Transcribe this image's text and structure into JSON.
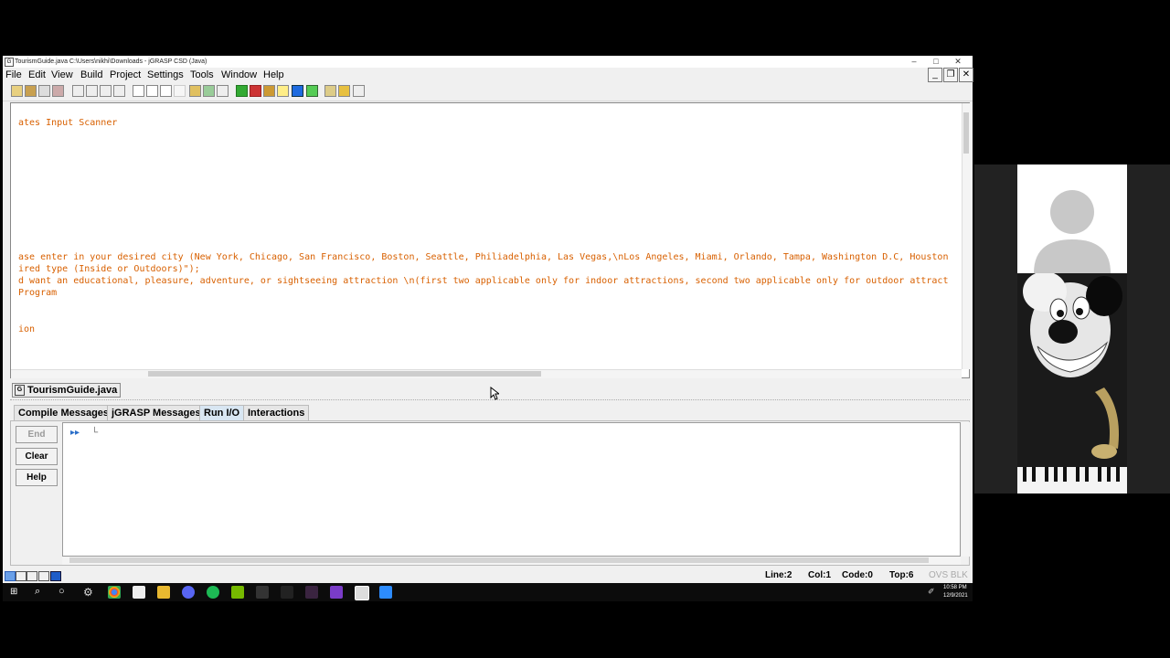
{
  "window": {
    "title": "TourismGuide.java  C:\\Users\\nikhi\\Downloads - jGRASP CSD (Java)",
    "controls": [
      "–",
      "□",
      "✕"
    ],
    "menus": [
      "File",
      "Edit",
      "View",
      "Build",
      "Project",
      "Settings",
      "Tools",
      "Window",
      "Help"
    ]
  },
  "editor": {
    "lines": [
      "ates Input Scanner",
      "ase enter in your desired city (New York, Chicago, San Francisco, Boston, Seattle, Philiadelphia, Las Vegas,\\nLos Angeles, Miami, Orlando, Tampa, Washington D.C, Houston",
      "ired type (Inside or Outdoors)\");",
      "d want an educational, pleasure, adventure, or sightseeing attraction \\n(first two applicable only for indoor attractions, second two applicable only for outdoor attract",
      "Program",
      "ion"
    ]
  },
  "file_tab": "TourismGuide.java",
  "message_tabs": [
    "Compile Messages",
    "jGRASP Messages",
    "Run I/O",
    "Interactions"
  ],
  "active_message_tab": "Run I/O",
  "run_buttons": {
    "end": "End",
    "clear": "Clear",
    "help": "Help"
  },
  "console": {
    "prompt": "▸▸",
    "cursor": "└"
  },
  "status": {
    "line": "Line:2",
    "col": "Col:1",
    "code": "Code:0",
    "top": "Top:6",
    "mode": "OVS BLK"
  },
  "taskbar": {
    "time": "10:58 PM",
    "date": "12/9/2021"
  },
  "colors": {
    "code_text": "#d86000",
    "accent_blue": "#0078d7"
  }
}
